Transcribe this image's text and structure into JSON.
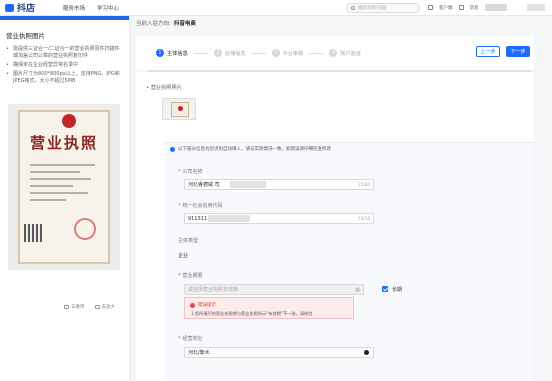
{
  "topbar": {
    "logo": "抖店",
    "nav": [
      "服务市场",
      "学习中心"
    ],
    "search_placeholder": "搜索功能/问题",
    "right_items": [
      "客户端",
      "消息"
    ]
  },
  "left_panel": {
    "title": "营业执照图片",
    "tips": [
      "需提供三证合一/二证合一的营业执照原件扫描件或加盖公司公章的营业执照复印件",
      "确保未在企业经营异常名录中",
      "图片尺寸为800*800px以上，支持PNG、JPG和JPEG格式，大小不超过5MB"
    ],
    "license_title": "营业执照",
    "actions": [
      "去重传",
      "去放大"
    ]
  },
  "breadcrumb": {
    "prefix": "当前入驻方向:",
    "value": "抖音电商"
  },
  "steps": [
    {
      "num": "1",
      "label": "主体信息"
    },
    {
      "num": "2",
      "label": "店铺信息"
    },
    {
      "num": "3",
      "label": "平台审核"
    },
    {
      "num": "4",
      "label": "账户验证"
    }
  ],
  "buttons": {
    "prev": "上一步",
    "next": "下一步"
  },
  "form": {
    "photo_label": "营业执照照片",
    "notice": "以下部分信息为您识别自动填入，请与实际情况一致，如错误请仔细检查修改",
    "company_name_label": "公司名称",
    "company_name_value": "河北睿德威        司",
    "company_name_count": "15/60",
    "credit_code_label": "统一社会信用代码",
    "credit_code_value": "911311",
    "credit_code_count": "18/18",
    "entity_type_label": "主体类型",
    "entity_type_value": "企业",
    "term_label": "营业期限",
    "term_placeholder": "请选择营业执照有效期",
    "long_term_label": "长期",
    "error_title": "错误提示",
    "error_text": "1.您所填写的营业执照期与营业执照所示“有效期”不一致，请核验",
    "address_label": "经营地址",
    "address_value": "河北/衡水"
  }
}
